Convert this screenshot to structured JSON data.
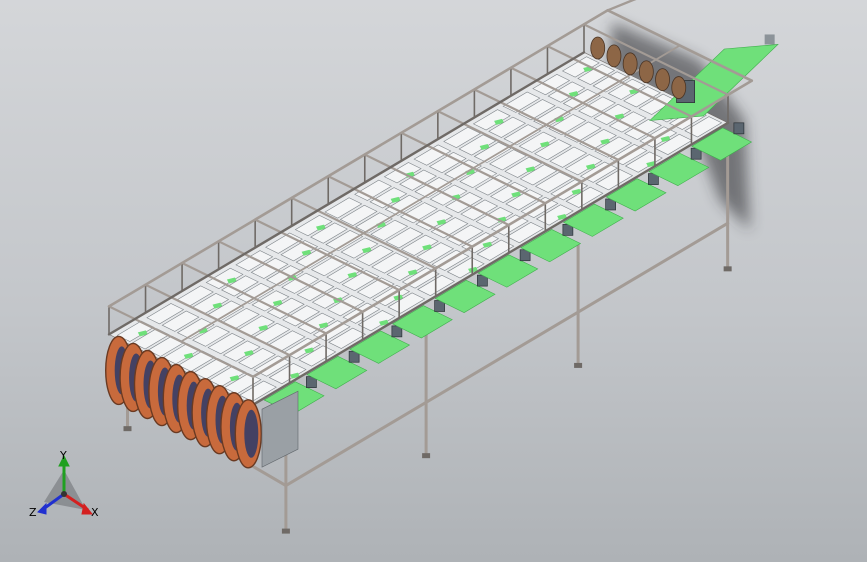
{
  "triad": {
    "x_label": "X",
    "y_label": "Y",
    "z_label": "Z",
    "x_color": "#d42020",
    "y_color": "#20a020",
    "z_color": "#2030d0"
  },
  "colors": {
    "frame": "#a39b95",
    "frame_dark": "#6f6a66",
    "belt": "#6fe07a",
    "belt_dark": "#3fae4c",
    "plate": "#f4f5f6",
    "guard": "#c86a3c",
    "guard_dark": "#6a3a22",
    "motor": "#5b6670"
  },
  "icons": [
    "coordinate-triad-icon"
  ]
}
